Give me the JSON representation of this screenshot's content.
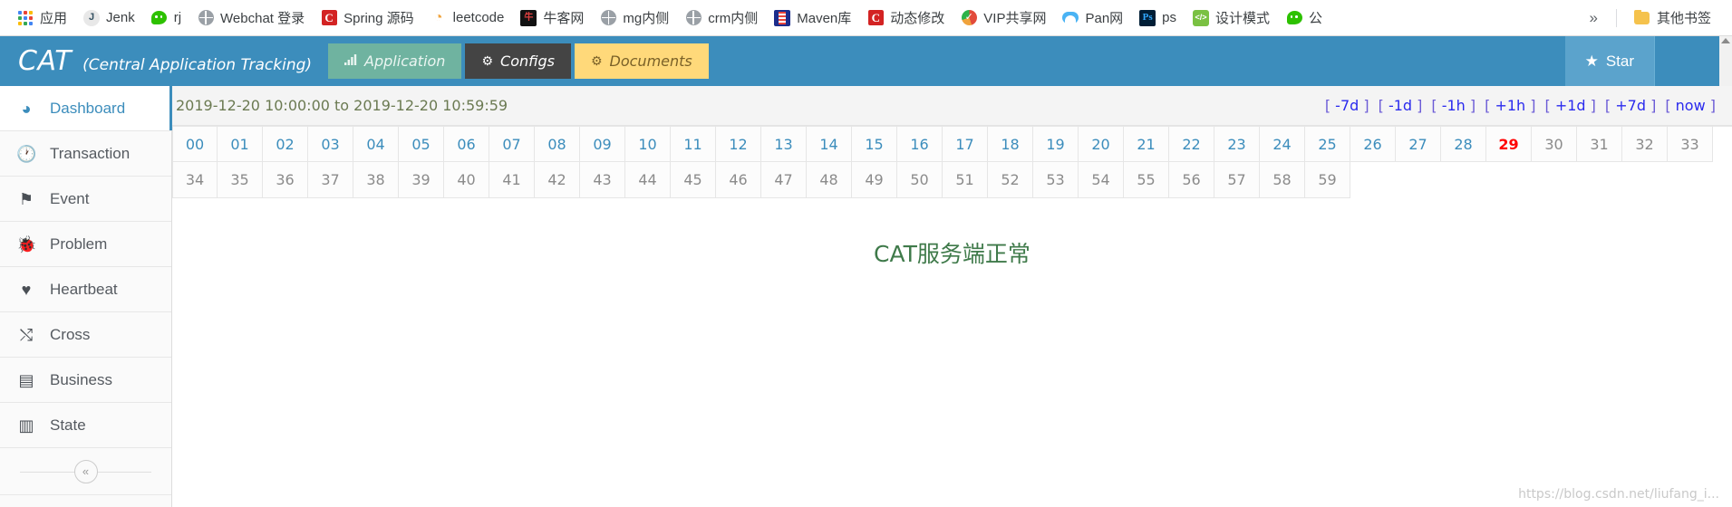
{
  "browser": {
    "bookmarks": [
      {
        "label": "应用",
        "icon": "apps-grid-icon"
      },
      {
        "label": "Jenk",
        "icon": "jenkins-icon"
      },
      {
        "label": "rj",
        "icon": "wechat-icon"
      },
      {
        "label": "Webchat 登录",
        "icon": "globe-icon"
      },
      {
        "label": "Spring 源码",
        "icon": "csdn-icon"
      },
      {
        "label": "leetcode",
        "icon": "leetcode-icon"
      },
      {
        "label": "牛客网",
        "icon": "nowcoder-icon"
      },
      {
        "label": "mg内侧",
        "icon": "globe-icon"
      },
      {
        "label": "crm内侧",
        "icon": "globe-icon"
      },
      {
        "label": "Maven库",
        "icon": "maven-icon"
      },
      {
        "label": "动态修改",
        "icon": "csdn-icon"
      },
      {
        "label": "VIP共享网",
        "icon": "vip-check-icon"
      },
      {
        "label": "Pan网",
        "icon": "pan-cloud-icon"
      },
      {
        "label": "ps",
        "icon": "photoshop-icon"
      },
      {
        "label": "设计模式",
        "icon": "design-pattern-icon"
      },
      {
        "label": "公",
        "icon": "wechat-icon"
      }
    ],
    "overflow_label": "»",
    "other_bookmarks": {
      "label": "其他书签",
      "icon": "folder-icon"
    }
  },
  "header": {
    "logo": "CAT",
    "subtitle": "(Central Application Tracking)",
    "tabs": [
      {
        "label": "Application",
        "icon": "bar-chart-icon",
        "style": "app"
      },
      {
        "label": "Configs",
        "icon": "gears-icon",
        "style": "configs"
      },
      {
        "label": "Documents",
        "icon": "gears-icon",
        "style": "docs"
      }
    ],
    "star": {
      "label": "Star",
      "icon": "star-icon"
    },
    "accent_color": "#3c8dbc"
  },
  "sidebar": {
    "items": [
      {
        "label": "Dashboard",
        "icon": "dashboard-icon",
        "active": true
      },
      {
        "label": "Transaction",
        "icon": "clock-icon",
        "active": false
      },
      {
        "label": "Event",
        "icon": "flag-icon",
        "active": false
      },
      {
        "label": "Problem",
        "icon": "bug-icon",
        "active": false
      },
      {
        "label": "Heartbeat",
        "icon": "heart-icon",
        "active": false
      },
      {
        "label": "Cross",
        "icon": "shuffle-icon",
        "active": false
      },
      {
        "label": "Business",
        "icon": "list-icon",
        "active": false
      },
      {
        "label": "State",
        "icon": "bar-chart-icon",
        "active": false
      }
    ],
    "collapse": {
      "icon": "chevron-double-left-icon",
      "label": "«"
    }
  },
  "timebar": {
    "range_text": "2019-12-20 10:00:00 to 2019-12-20 10:59:59",
    "links": [
      {
        "label": "-7d"
      },
      {
        "label": "-1d"
      },
      {
        "label": "-1h"
      },
      {
        "label": "+1h"
      },
      {
        "label": "+1d"
      },
      {
        "label": "+7d"
      },
      {
        "label": "now"
      }
    ]
  },
  "minute_grid": {
    "current_minute": "29",
    "rows": [
      {
        "cells": [
          {
            "label": "00",
            "state": "link"
          },
          {
            "label": "01",
            "state": "link"
          },
          {
            "label": "02",
            "state": "link"
          },
          {
            "label": "03",
            "state": "link"
          },
          {
            "label": "04",
            "state": "link"
          },
          {
            "label": "05",
            "state": "link"
          },
          {
            "label": "06",
            "state": "link"
          },
          {
            "label": "07",
            "state": "link"
          },
          {
            "label": "08",
            "state": "link"
          },
          {
            "label": "09",
            "state": "link"
          },
          {
            "label": "10",
            "state": "link"
          },
          {
            "label": "11",
            "state": "link"
          },
          {
            "label": "12",
            "state": "link"
          },
          {
            "label": "13",
            "state": "link"
          },
          {
            "label": "14",
            "state": "link"
          },
          {
            "label": "15",
            "state": "link"
          },
          {
            "label": "16",
            "state": "link"
          },
          {
            "label": "17",
            "state": "link"
          },
          {
            "label": "18",
            "state": "link"
          },
          {
            "label": "19",
            "state": "link"
          },
          {
            "label": "20",
            "state": "link"
          },
          {
            "label": "21",
            "state": "link"
          },
          {
            "label": "22",
            "state": "link"
          },
          {
            "label": "23",
            "state": "link"
          },
          {
            "label": "24",
            "state": "link"
          },
          {
            "label": "25",
            "state": "link"
          },
          {
            "label": "26",
            "state": "link"
          },
          {
            "label": "27",
            "state": "link"
          },
          {
            "label": "28",
            "state": "link"
          },
          {
            "label": "29",
            "state": "current"
          },
          {
            "label": "30",
            "state": "muted"
          },
          {
            "label": "31",
            "state": "muted"
          },
          {
            "label": "32",
            "state": "muted"
          },
          {
            "label": "33",
            "state": "muted"
          }
        ]
      },
      {
        "cells": [
          {
            "label": "34",
            "state": "muted"
          },
          {
            "label": "35",
            "state": "muted"
          },
          {
            "label": "36",
            "state": "muted"
          },
          {
            "label": "37",
            "state": "muted"
          },
          {
            "label": "38",
            "state": "muted"
          },
          {
            "label": "39",
            "state": "muted"
          },
          {
            "label": "40",
            "state": "muted"
          },
          {
            "label": "41",
            "state": "muted"
          },
          {
            "label": "42",
            "state": "muted"
          },
          {
            "label": "43",
            "state": "muted"
          },
          {
            "label": "44",
            "state": "muted"
          },
          {
            "label": "45",
            "state": "muted"
          },
          {
            "label": "46",
            "state": "muted"
          },
          {
            "label": "47",
            "state": "muted"
          },
          {
            "label": "48",
            "state": "muted"
          },
          {
            "label": "49",
            "state": "muted"
          },
          {
            "label": "50",
            "state": "muted"
          },
          {
            "label": "51",
            "state": "muted"
          },
          {
            "label": "52",
            "state": "muted"
          },
          {
            "label": "53",
            "state": "muted"
          },
          {
            "label": "54",
            "state": "muted"
          },
          {
            "label": "55",
            "state": "muted"
          },
          {
            "label": "56",
            "state": "muted"
          },
          {
            "label": "57",
            "state": "muted"
          },
          {
            "label": "58",
            "state": "muted"
          },
          {
            "label": "59",
            "state": "muted"
          }
        ]
      }
    ]
  },
  "content": {
    "status_message": "CAT服务端正常",
    "status_color": "#3f7a4a"
  },
  "watermark": "https://blog.csdn.net/liufang_i..."
}
